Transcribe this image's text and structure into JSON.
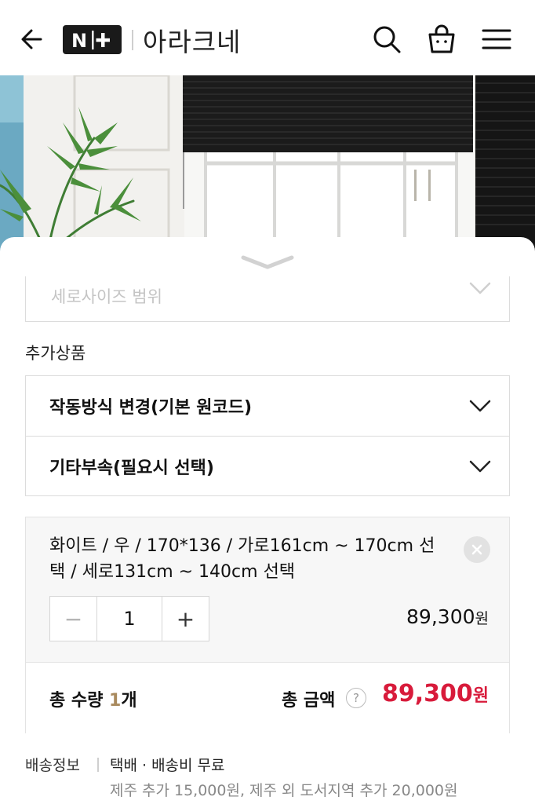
{
  "header": {
    "logo_text": "N+",
    "store_name": "아라크네",
    "icons": [
      "back-arrow-icon",
      "search-icon",
      "shopping-bag-icon",
      "hamburger-menu-icon"
    ]
  },
  "options": {
    "faded_select_label": "세로사이즈 범위"
  },
  "addons": {
    "section_label": "추가상품",
    "items": [
      {
        "label": "작동방식 변경(기본 원코드)"
      },
      {
        "label": "기타부속(필요시 선택)"
      }
    ]
  },
  "selected_item": {
    "description": "화이트 / 우 / 170*136 / 가로161cm ~ 170cm 선택 / 세로131cm ~ 140cm 선택",
    "minus_symbol": "−",
    "quantity": "1",
    "plus_symbol": "+",
    "price": "89,300",
    "currency": "원"
  },
  "total": {
    "qty_prefix": "총 수량 ",
    "qty_value": "1",
    "qty_suffix": "개",
    "amount_label": "총 금액",
    "help_symbol": "?",
    "amount": "89,300",
    "currency": "원"
  },
  "shipping": {
    "label": "배송정보",
    "method": "택배 · 배송비 무료",
    "extra": "제주 추가 15,000원, 제주 외 도서지역 추가 20,000원"
  },
  "colors": {
    "price_accent": "#d81b3b",
    "quantity_accent": "#a98a5e"
  }
}
